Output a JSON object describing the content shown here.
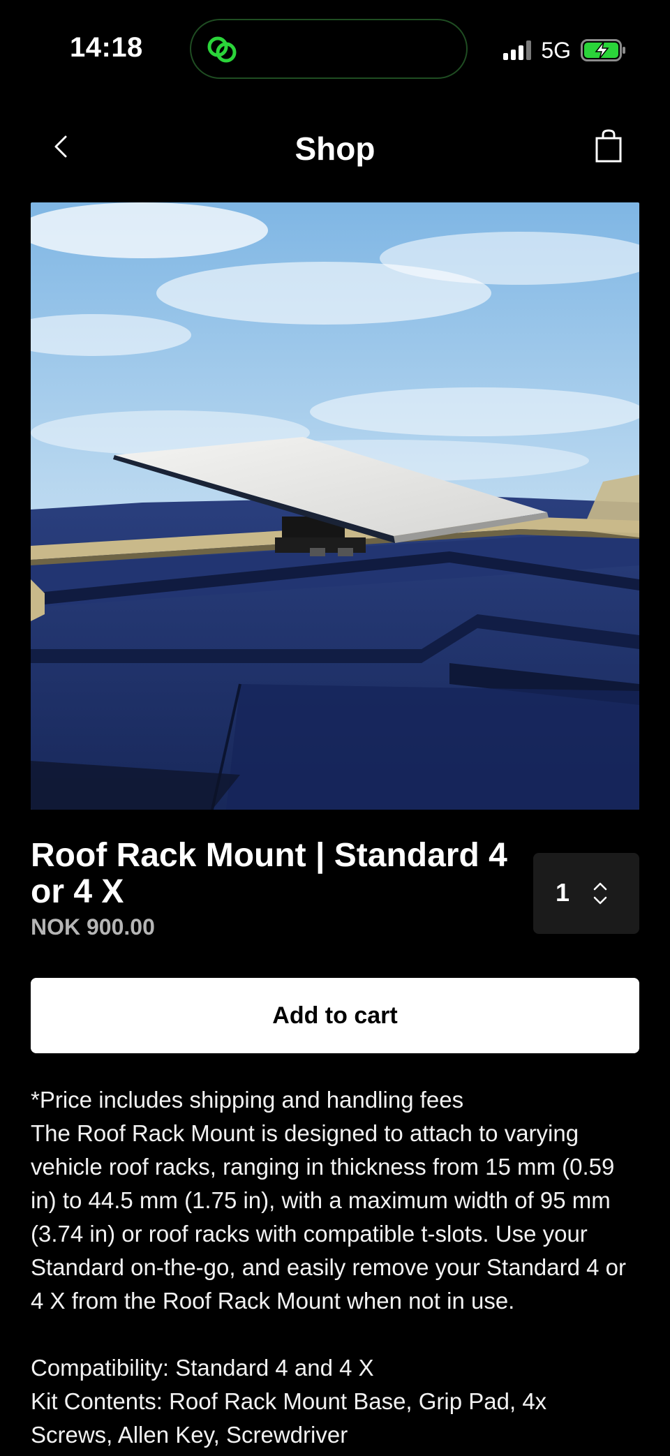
{
  "status_bar": {
    "time": "14:18",
    "network": "5G",
    "icons": [
      "chat-bubbles-icon",
      "signal-icon",
      "battery-charging-icon"
    ],
    "accent_color": "#2bd43a"
  },
  "header": {
    "title": "Shop",
    "icons": [
      "chevron-left-icon",
      "shopping-bag-icon"
    ]
  },
  "product": {
    "title": "Roof Rack Mount | Standard 4 or 4 X",
    "price": "NOK 900.00",
    "quantity": "1",
    "add_to_cart_label": "Add to cart"
  },
  "description": {
    "line1": "*Price includes shipping and handling fees",
    "line2": "The Roof Rack Mount is designed to attach to varying vehicle roof racks, ranging in thickness from 15 mm (0.59 in) to 44.5 mm (1.75 in), with a maximum width of 95 mm (3.74 in) or roof racks with compatible t-slots. Use your Standard on-the-go, and easily remove your Standard 4 or 4 X from the Roof Rack Mount when not in use.",
    "compatibility": "Compatibility: Standard 4 and 4 X",
    "kit_contents": "Kit Contents: Roof Rack Mount Base, Grip Pad, 4x Screws, Allen Key, Screwdriver"
  }
}
